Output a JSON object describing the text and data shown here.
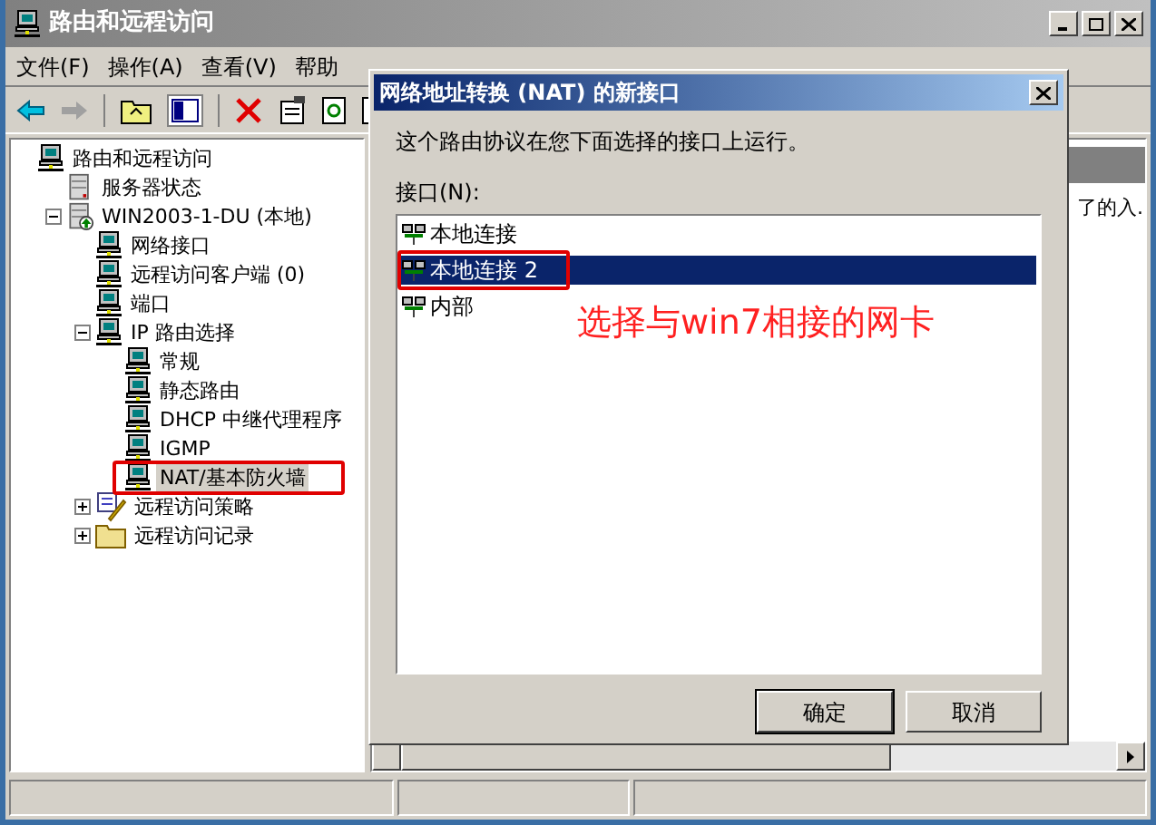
{
  "window": {
    "title": "路由和远程访问",
    "active": false
  },
  "menu": [
    "文件(F)",
    "操作(A)",
    "查看(V)",
    "帮助"
  ],
  "tree": [
    {
      "label": "路由和远程访问",
      "kind": "computer",
      "selected": false,
      "children": [
        {
          "label": "服务器状态",
          "kind": "server",
          "selected": false
        },
        {
          "label": "WIN2003-1-DU (本地)",
          "kind": "host",
          "selected": false,
          "expanded": true,
          "children": [
            {
              "label": "网络接口",
              "kind": "computer",
              "selected": false
            },
            {
              "label": "远程访问客户端 (0)",
              "kind": "computer",
              "selected": false
            },
            {
              "label": "端口",
              "kind": "computer",
              "selected": false
            },
            {
              "label": "IP 路由选择",
              "kind": "computer",
              "selected": false,
              "expanded": true,
              "children": [
                {
                  "label": "常规",
                  "kind": "computer",
                  "selected": false
                },
                {
                  "label": "静态路由",
                  "kind": "computer",
                  "selected": false
                },
                {
                  "label": "DHCP 中继代理程序",
                  "kind": "computer",
                  "selected": false
                },
                {
                  "label": "IGMP",
                  "kind": "computer",
                  "selected": false
                },
                {
                  "label": "NAT/基本防火墙",
                  "kind": "computer",
                  "selected": true
                }
              ]
            },
            {
              "label": "远程访问策略",
              "kind": "policy",
              "selected": false,
              "expanded": false
            },
            {
              "label": "远程访问记录",
              "kind": "folder",
              "selected": false,
              "expanded": false
            }
          ]
        }
      ]
    }
  ],
  "right_pane": {
    "column_text": "了的入."
  },
  "dialog": {
    "title": "网络地址转换 (NAT) 的新接口",
    "active": true,
    "instruction": "这个路由协议在您下面选择的接口上运行。",
    "list_label": "接口(N):",
    "interfaces": [
      {
        "label": "本地连接",
        "selected": false
      },
      {
        "label": "本地连接 2",
        "selected": true
      },
      {
        "label": "内部",
        "selected": false
      }
    ],
    "buttons": [
      {
        "label": "确定",
        "default": true
      },
      {
        "label": "取消",
        "default": false
      }
    ]
  },
  "annotation": {
    "text": "选择与win7相接的网卡"
  }
}
